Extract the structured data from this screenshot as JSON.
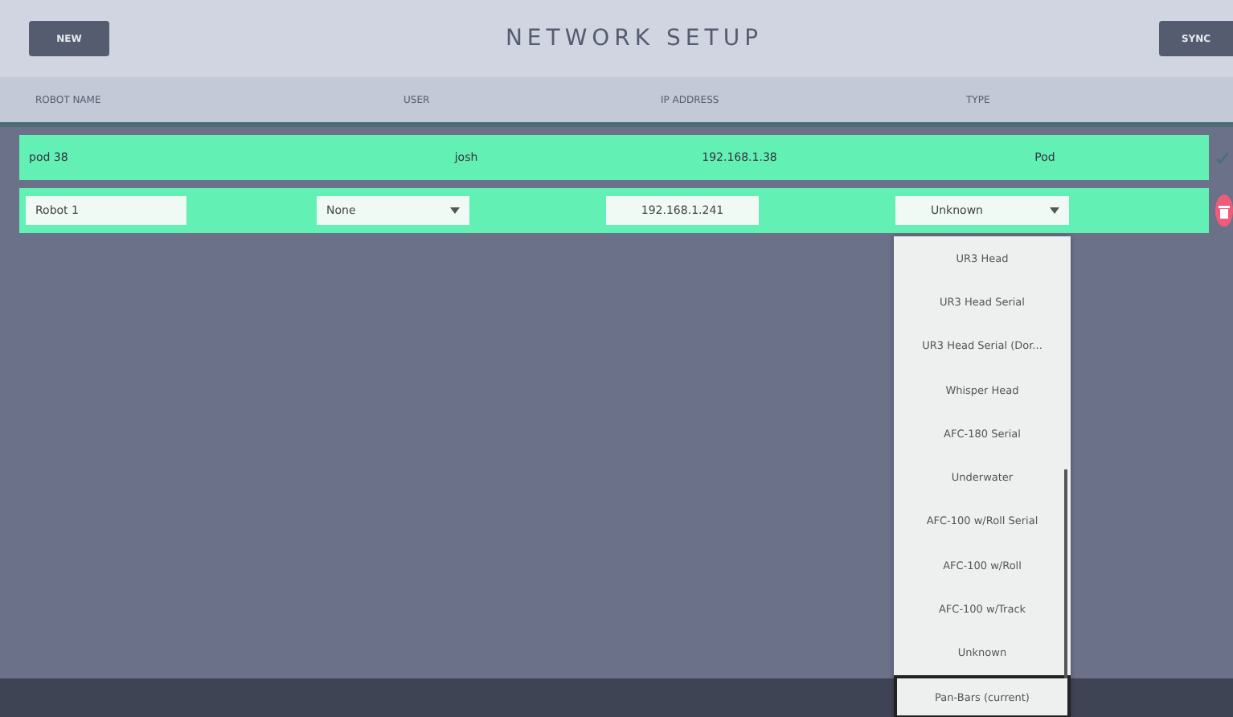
{
  "header": {
    "left_button": "NEW",
    "title": "NETWORK SETUP",
    "right_button": "SYNC"
  },
  "columns": [
    "ROBOT NAME",
    "USER",
    "IP ADDRESS",
    "TYPE"
  ],
  "rows": [
    {
      "kind": "saved",
      "name": "pod 38",
      "user": "josh",
      "ip": "192.168.1.38",
      "type": "Pod"
    },
    {
      "kind": "editing",
      "name": "Robot 1",
      "user": "None",
      "ip": "192.168.1.241",
      "type": "Unknown"
    }
  ],
  "dropdown": {
    "options": [
      {
        "label": "UR3 Head",
        "selected": false
      },
      {
        "label": "UR3 Head Serial",
        "selected": false
      },
      {
        "label": "UR3 Head Serial (Dor...",
        "selected": false
      },
      {
        "label": "Whisper Head",
        "selected": false
      },
      {
        "label": "AFC-180 Serial",
        "selected": false
      },
      {
        "label": "Underwater",
        "selected": false
      },
      {
        "label": "AFC-100 w/Roll Serial",
        "selected": false
      },
      {
        "label": "AFC-100 w/Roll",
        "selected": false
      },
      {
        "label": "AFC-100 w/Track",
        "selected": false
      },
      {
        "label": "Unknown",
        "selected": false
      },
      {
        "label": "Pan-Bars (current)",
        "selected": true
      }
    ]
  }
}
